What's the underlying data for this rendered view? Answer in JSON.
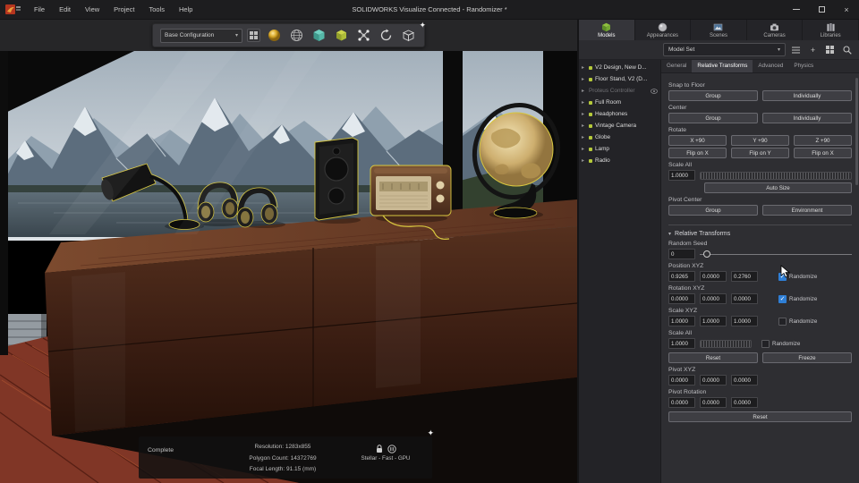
{
  "window": {
    "title": "SOLIDWORKS Visualize Connected - Randomizer *",
    "menus": [
      "File",
      "Edit",
      "View",
      "Project",
      "Tools",
      "Help"
    ],
    "controls": {
      "close": "×"
    }
  },
  "toolbar": {
    "config": "Base Configuration"
  },
  "panel": {
    "tabs": [
      {
        "label": "Models"
      },
      {
        "label": "Appearances"
      },
      {
        "label": "Scenes"
      },
      {
        "label": "Cameras"
      },
      {
        "label": "Libraries"
      }
    ],
    "model_set": "Model Set",
    "tree": [
      {
        "label": "V2 Design, New D..."
      },
      {
        "label": "Floor Stand, V2 (D..."
      },
      {
        "label": "Proteus Controller",
        "dimmed": true
      },
      {
        "label": "Full Room"
      },
      {
        "label": "Headphones"
      },
      {
        "label": "Vintage Camera"
      },
      {
        "label": "Globe"
      },
      {
        "label": "Lamp"
      },
      {
        "label": "Radio"
      }
    ],
    "subtabs": [
      {
        "label": "General"
      },
      {
        "label": "Relative Transforms",
        "active": true
      },
      {
        "label": "Advanced"
      },
      {
        "label": "Physics"
      }
    ],
    "snap_to_floor": {
      "label": "Snap to Floor",
      "group": "Group",
      "individually": "Individually"
    },
    "center": {
      "label": "Center",
      "group": "Group",
      "individually": "Individually"
    },
    "rotate": {
      "label": "Rotate",
      "x90": "X +90",
      "y90": "Y +90",
      "z90": "Z +90",
      "flipx": "Flip on X",
      "flipy": "Flip on Y",
      "flipz": "Flip on X"
    },
    "scale_all": {
      "label": "Scale All",
      "value": "1.0000"
    },
    "auto_size": "Auto Size",
    "pivot_center": {
      "label": "Pivot Center",
      "group": "Group",
      "environment": "Environment"
    },
    "rt": {
      "header": "Relative Transforms",
      "random_seed": {
        "label": "Random Seed",
        "value": "0"
      },
      "position": {
        "label": "Position XYZ",
        "x": "0.9265",
        "y": "0.0000",
        "z": "0.2760",
        "randomize": "Randomize",
        "checked": true
      },
      "rotation": {
        "label": "Rotation XYZ",
        "x": "0.0000",
        "y": "0.0000",
        "z": "0.0000",
        "randomize": "Randomize",
        "checked": true
      },
      "scale_xyz": {
        "label": "Scale XYZ",
        "x": "1.0000",
        "y": "1.0000",
        "z": "1.0000",
        "randomize": "Randomize",
        "checked": false
      },
      "scale_all": {
        "label": "Scale All",
        "value": "1.0000",
        "randomize": "Randomize",
        "checked": false
      },
      "reset": "Reset",
      "freeze": "Freeze",
      "pivot_xyz": {
        "label": "Pivot XYZ",
        "x": "0.0000",
        "y": "0.0000",
        "z": "0.0000"
      },
      "pivot_rotation": {
        "label": "Pivot Rotation",
        "x": "0.0000",
        "y": "0.0000",
        "z": "0.0000"
      },
      "reset2": "Reset"
    },
    "colors": {
      "accent_check": "#2f7fd6",
      "model_dot": "#b5c93a",
      "selection_outline": "#d7c63f"
    }
  },
  "status": {
    "state": "Complete",
    "resolution": "Resolution: 1283x855",
    "polygons": "Polygon Count: 14372769",
    "focal": "Focal Length: 91.15 (mm)",
    "renderer": "Stellar - Fast - GPU"
  }
}
